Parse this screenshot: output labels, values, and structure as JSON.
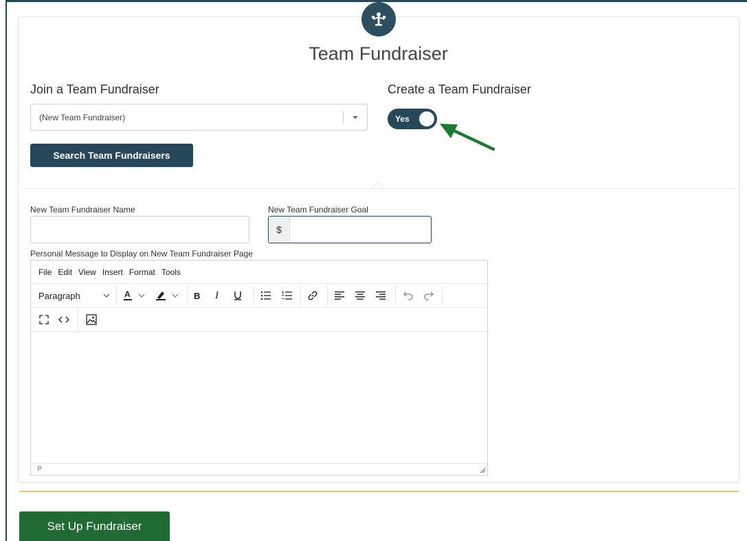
{
  "header": {
    "title": "Team Fundraiser"
  },
  "join": {
    "label": "Join a Team Fundraiser",
    "select_value": "(New Team Fundraiser)",
    "search_button": "Search Team Fundraisers"
  },
  "create": {
    "label": "Create a Team Fundraiser",
    "toggle_text": "Yes"
  },
  "form": {
    "name_label": "New Team Fundraiser Name",
    "goal_label": "New Team Fundraiser Goal",
    "goal_prefix": "$",
    "message_label": "Personal Message to Display on New Team Fundraiser Page"
  },
  "editor": {
    "menu": [
      "File",
      "Edit",
      "View",
      "Insert",
      "Format",
      "Tools"
    ],
    "block_format": "Paragraph",
    "bold": "B",
    "italic": "I",
    "status_path": "P"
  },
  "footer": {
    "setup_button": "Set Up Fundraiser"
  },
  "colors": {
    "primary": "#27485a",
    "success": "#1f6b33",
    "accent_line": "#f0c27a",
    "arrow": "#1e7a2e"
  }
}
